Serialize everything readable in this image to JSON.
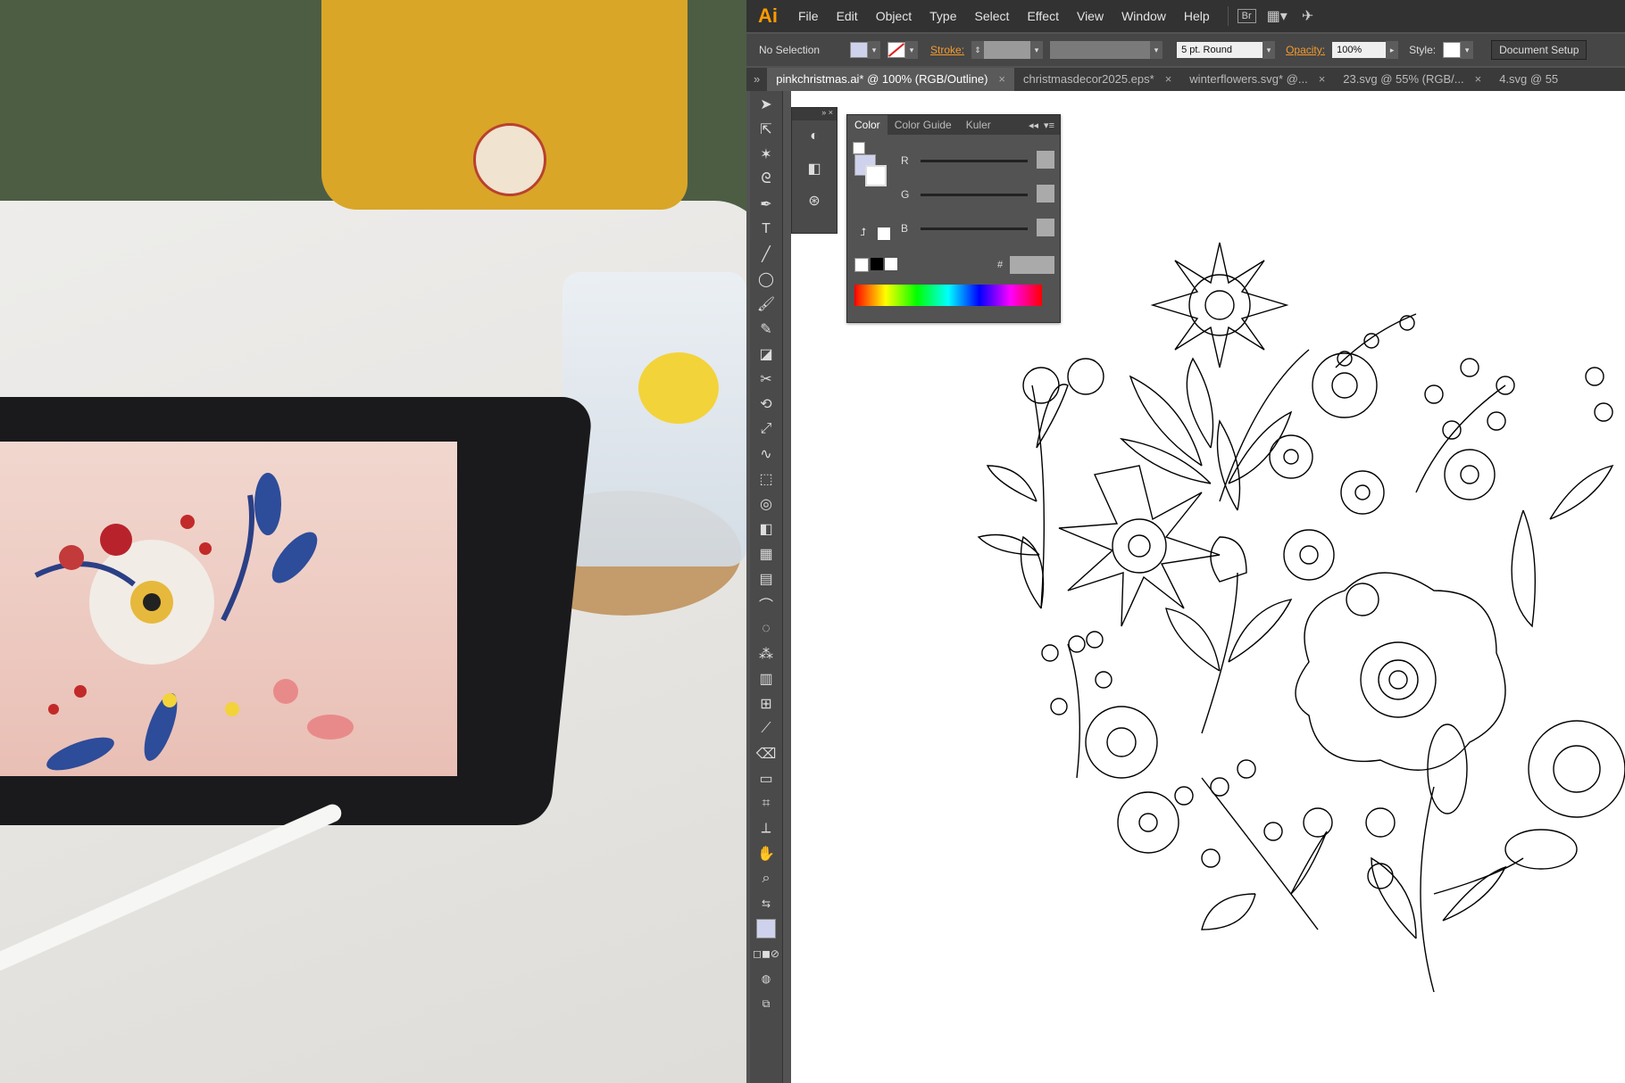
{
  "app": {
    "logo": "Ai"
  },
  "menu": [
    "File",
    "Edit",
    "Object",
    "Type",
    "Select",
    "Effect",
    "View",
    "Window",
    "Help"
  ],
  "menu_extras": {
    "bridge": "Br"
  },
  "control_bar": {
    "selection": "No Selection",
    "stroke_label": "Stroke:",
    "brush": "5 pt. Round",
    "opacity_label": "Opacity:",
    "opacity_value": "100%",
    "style_label": "Style:",
    "document_setup": "Document Setup"
  },
  "tabs": [
    "pinkchristmas.ai* @ 100% (RGB/Outline)",
    "christmasdecor2025.eps*",
    "winterflowers.svg* @...",
    "23.svg @ 55% (RGB/...",
    "4.svg @ 55"
  ],
  "color_panel": {
    "tabs": [
      "Color",
      "Color Guide",
      "Kuler"
    ],
    "channels": [
      "R",
      "G",
      "B"
    ],
    "hex_label": "#"
  },
  "colors": {
    "menubar": "#323232",
    "panel": "#535353",
    "accent": "#f29a2e",
    "logo": "#ff9a00"
  }
}
